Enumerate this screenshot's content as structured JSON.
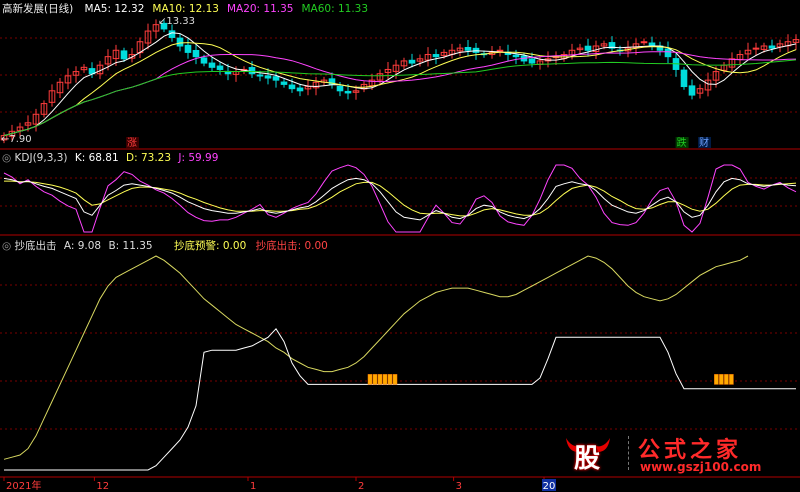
{
  "colors": {
    "background": "#000000",
    "up": "#ff3c3c",
    "down": "#00dcdc",
    "ma5": "#ffffff",
    "ma10": "#ffff55",
    "ma20": "#ff44ff",
    "ma60": "#22cc22",
    "grid": "#7a0000",
    "panel_border": "#b00000"
  },
  "main_panel": {
    "title": "高新发展(日线)",
    "indicators": [
      {
        "label": "MA5: 12.32",
        "color": "#ffffff"
      },
      {
        "label": "MA10: 12.13",
        "color": "#ffff55"
      },
      {
        "label": "MA20: 11.35",
        "color": "#ff44ff"
      },
      {
        "label": "MA60: 11.33",
        "color": "#22cc22"
      }
    ],
    "high_marker": "13.33",
    "low_marker": "7.90",
    "tags": [
      {
        "text": "涨",
        "color": "#ff3c3c",
        "bg": "#3a0000",
        "x_index": 0.165
      },
      {
        "text": "跌",
        "color": "#22cc22",
        "bg": "#003a00",
        "x_index": 0.852
      },
      {
        "text": "财",
        "color": "#6aa0ff",
        "bg": "#001a44",
        "x_index": 0.88
      }
    ]
  },
  "kdj_panel": {
    "title": "KDJ(9,3,3)",
    "k_label": "K: 68.81",
    "d_label": "D: 73.23",
    "j_label": "J: 59.99",
    "k_color": "#ffffff",
    "d_color": "#ffff55",
    "j_color": "#ff44ff"
  },
  "bottom_panel": {
    "title": "抄底出击",
    "a_label": "A: 9.08",
    "b_label": "B: 11.35",
    "warn_label": "抄底预警: 0.00",
    "hit_label": "抄底出击: 0.00",
    "warn_color": "#ffff55",
    "hit_color": "#ff4444"
  },
  "axis": {
    "labels": [
      {
        "text": "2021年",
        "pos": 0.005
      },
      {
        "text": "12",
        "pos": 0.118
      },
      {
        "text": "1",
        "pos": 0.31
      },
      {
        "text": "2",
        "pos": 0.445
      },
      {
        "text": "3",
        "pos": 0.567
      },
      {
        "text": "20",
        "pos": 0.68,
        "highlight": true
      }
    ]
  },
  "watermark": {
    "logo_char": "股",
    "name": "公式之家",
    "url": "www.gszj100.com"
  },
  "chart_data": {
    "type": "line",
    "note_series": "approximate values read from pixels, index 0..99 across the visible range",
    "price_close": [
      7.9,
      8.1,
      8.3,
      8.5,
      8.9,
      9.4,
      10.0,
      10.4,
      10.7,
      10.9,
      11.1,
      10.8,
      11.2,
      11.6,
      11.9,
      11.5,
      11.7,
      12.3,
      12.8,
      13.1,
      12.9,
      12.5,
      12.1,
      11.8,
      11.6,
      11.3,
      11.1,
      11.0,
      10.8,
      10.9,
      11.0,
      10.8,
      10.7,
      10.6,
      10.5,
      10.3,
      10.1,
      10.0,
      10.2,
      10.4,
      10.5,
      10.3,
      10.0,
      9.9,
      10.0,
      10.3,
      10.5,
      10.8,
      11.0,
      11.2,
      11.4,
      11.3,
      11.5,
      11.7,
      11.6,
      11.8,
      11.9,
      12.0,
      11.9,
      11.8,
      11.7,
      11.8,
      11.9,
      11.7,
      11.6,
      11.4,
      11.3,
      11.4,
      11.5,
      11.6,
      11.7,
      11.9,
      12.0,
      11.9,
      12.1,
      12.2,
      12.0,
      11.9,
      12.0,
      12.2,
      12.3,
      12.1,
      11.9,
      11.6,
      11.0,
      10.2,
      9.8,
      10.1,
      10.5,
      10.9,
      11.2,
      11.5,
      11.7,
      11.9,
      12.0,
      12.1,
      12.0,
      12.2,
      12.3,
      12.4
    ],
    "kdj_k": [
      80,
      78,
      74,
      76,
      72,
      68,
      65,
      60,
      55,
      50,
      30,
      25,
      40,
      55,
      62,
      70,
      72,
      70,
      68,
      65,
      62,
      58,
      52,
      45,
      40,
      35,
      32,
      30,
      28,
      28,
      30,
      32,
      35,
      30,
      28,
      30,
      33,
      36,
      38,
      45,
      55,
      65,
      72,
      78,
      80,
      78,
      72,
      60,
      45,
      30,
      22,
      20,
      18,
      25,
      32,
      28,
      22,
      20,
      25,
      35,
      40,
      38,
      30,
      25,
      22,
      20,
      25,
      35,
      50,
      68,
      72,
      75,
      72,
      70,
      62,
      50,
      40,
      35,
      30,
      28,
      32,
      40,
      48,
      52,
      45,
      30,
      22,
      25,
      40,
      60,
      75,
      80,
      78,
      72,
      70,
      68,
      70,
      72,
      70,
      69
    ],
    "kdj_d": [
      76,
      76,
      75,
      75,
      74,
      72,
      70,
      67,
      63,
      58,
      48,
      40,
      42,
      48,
      54,
      60,
      65,
      67,
      67,
      66,
      64,
      62,
      58,
      53,
      49,
      44,
      40,
      36,
      33,
      31,
      31,
      31,
      32,
      32,
      31,
      31,
      32,
      34,
      35,
      39,
      45,
      52,
      60,
      66,
      72,
      74,
      74,
      69,
      60,
      50,
      40,
      33,
      28,
      27,
      28,
      28,
      26,
      24,
      24,
      28,
      33,
      35,
      33,
      30,
      27,
      25,
      25,
      28,
      36,
      47,
      57,
      65,
      68,
      70,
      67,
      61,
      53,
      47,
      40,
      35,
      34,
      36,
      41,
      45,
      45,
      40,
      34,
      31,
      34,
      43,
      54,
      64,
      70,
      71,
      71,
      70,
      70,
      71,
      72,
      73
    ],
    "kdj_j": [
      88,
      82,
      72,
      78,
      68,
      60,
      55,
      46,
      39,
      34,
      0,
      0,
      36,
      69,
      78,
      90,
      86,
      76,
      70,
      63,
      58,
      50,
      40,
      29,
      22,
      17,
      16,
      18,
      18,
      22,
      28,
      34,
      41,
      26,
      22,
      28,
      35,
      40,
      44,
      57,
      75,
      91,
      96,
      100,
      96,
      86,
      68,
      42,
      15,
      0,
      0,
      0,
      0,
      21,
      40,
      28,
      14,
      12,
      27,
      49,
      54,
      44,
      24,
      15,
      12,
      10,
      25,
      49,
      78,
      100,
      100,
      95,
      80,
      70,
      52,
      28,
      14,
      11,
      10,
      14,
      28,
      48,
      62,
      66,
      45,
      10,
      0,
      13,
      52,
      94,
      100,
      100,
      94,
      74,
      68,
      64,
      70,
      74,
      66,
      60
    ],
    "bottom_yellow": [
      0.05,
      0.06,
      0.07,
      0.1,
      0.16,
      0.24,
      0.32,
      0.4,
      0.48,
      0.56,
      0.64,
      0.72,
      0.8,
      0.86,
      0.9,
      0.92,
      0.94,
      0.96,
      0.98,
      1.0,
      0.98,
      0.95,
      0.92,
      0.88,
      0.84,
      0.8,
      0.77,
      0.74,
      0.71,
      0.68,
      0.66,
      0.64,
      0.62,
      0.6,
      0.57,
      0.55,
      0.52,
      0.5,
      0.48,
      0.47,
      0.46,
      0.46,
      0.47,
      0.48,
      0.5,
      0.53,
      0.57,
      0.61,
      0.65,
      0.69,
      0.73,
      0.76,
      0.79,
      0.81,
      0.83,
      0.84,
      0.85,
      0.85,
      0.85,
      0.84,
      0.83,
      0.82,
      0.81,
      0.81,
      0.82,
      0.84,
      0.86,
      0.88,
      0.9,
      0.92,
      0.94,
      0.96,
      0.98,
      1.0,
      0.99,
      0.97,
      0.94,
      0.9,
      0.86,
      0.83,
      0.81,
      0.8,
      0.79,
      0.8,
      0.82,
      0.85,
      0.88,
      0.91,
      0.93,
      0.95,
      0.96,
      0.97,
      0.98,
      1.0
    ],
    "bottom_white": [
      0.0,
      0.0,
      0.0,
      0.0,
      0.0,
      0.0,
      0.0,
      0.0,
      0.0,
      0.0,
      0.0,
      0.0,
      0.0,
      0.0,
      0.0,
      0.0,
      0.0,
      0.0,
      0.0,
      0.02,
      0.06,
      0.1,
      0.14,
      0.2,
      0.3,
      0.55,
      0.56,
      0.56,
      0.56,
      0.56,
      0.57,
      0.58,
      0.6,
      0.62,
      0.66,
      0.6,
      0.5,
      0.44,
      0.4,
      0.4,
      0.4,
      0.4,
      0.4,
      0.4,
      0.4,
      0.4,
      0.4,
      0.4,
      0.4,
      0.4,
      0.4,
      0.4,
      0.4,
      0.4,
      0.4,
      0.4,
      0.4,
      0.4,
      0.4,
      0.4,
      0.4,
      0.4,
      0.4,
      0.4,
      0.4,
      0.4,
      0.4,
      0.43,
      0.52,
      0.62,
      0.62,
      0.62,
      0.62,
      0.62,
      0.62,
      0.62,
      0.62,
      0.62,
      0.62,
      0.62,
      0.62,
      0.62,
      0.62,
      0.55,
      0.45,
      0.38,
      0.38,
      0.38,
      0.38,
      0.38,
      0.38,
      0.38,
      0.38,
      0.38,
      0.38,
      0.38,
      0.38,
      0.38,
      0.38,
      0.38
    ],
    "signal_bars": [
      {
        "start": 0.46,
        "end": 0.495
      },
      {
        "start": 0.893,
        "end": 0.912
      }
    ]
  }
}
